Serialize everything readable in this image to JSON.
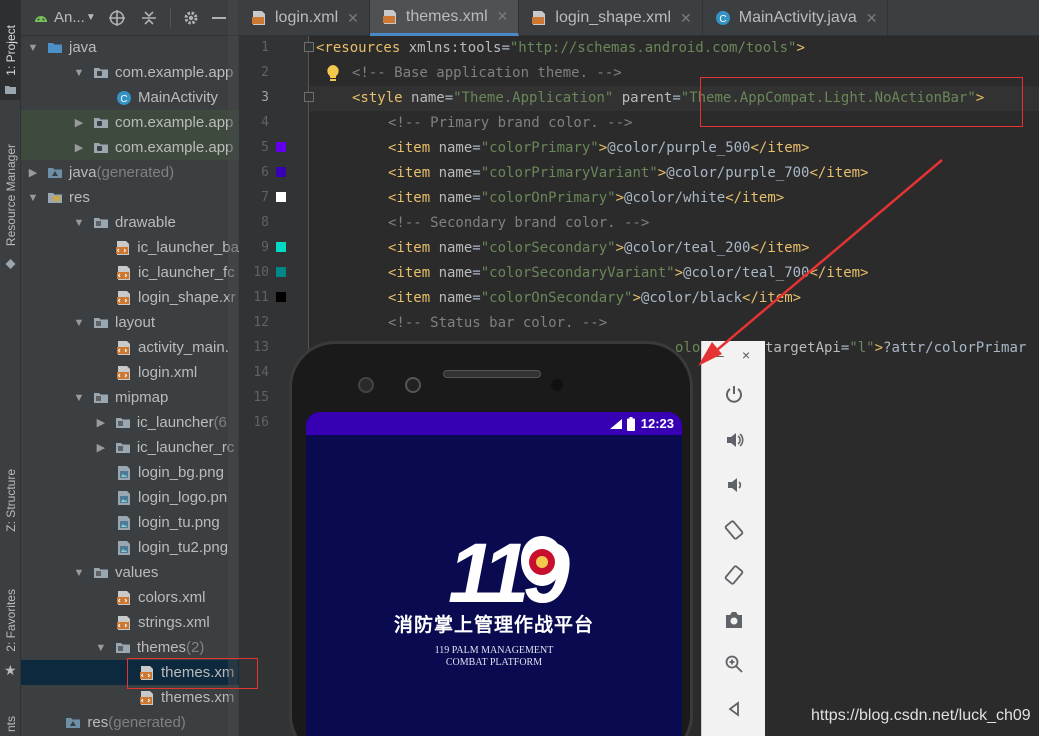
{
  "toolstrip": {
    "project": "1: Project",
    "resource_manager": "Resource Manager",
    "structure": "Z: Structure",
    "favorites": "2: Favorites",
    "bottom_cut": "nts"
  },
  "project_panel": {
    "title": "An...",
    "tree": [
      {
        "label": "java",
        "dim": ""
      },
      {
        "label": "com.example.app",
        "dim": ""
      },
      {
        "label": "MainActivity",
        "dim": ""
      },
      {
        "label": "com.example.app",
        "dim": ""
      },
      {
        "label": "com.example.app",
        "dim": ""
      },
      {
        "label": "java",
        "dim": " (generated)"
      },
      {
        "label": "res",
        "dim": ""
      },
      {
        "label": "drawable",
        "dim": ""
      },
      {
        "label": "ic_launcher_ba",
        "dim": ""
      },
      {
        "label": "ic_launcher_fc",
        "dim": ""
      },
      {
        "label": "login_shape.xr",
        "dim": ""
      },
      {
        "label": "layout",
        "dim": ""
      },
      {
        "label": "activity_main.",
        "dim": ""
      },
      {
        "label": "login.xml",
        "dim": ""
      },
      {
        "label": "mipmap",
        "dim": ""
      },
      {
        "label": "ic_launcher",
        "dim": " (6"
      },
      {
        "label": "ic_launcher_rc",
        "dim": ""
      },
      {
        "label": "login_bg.png",
        "dim": ""
      },
      {
        "label": "login_logo.pn",
        "dim": ""
      },
      {
        "label": "login_tu.png",
        "dim": ""
      },
      {
        "label": "login_tu2.png",
        "dim": ""
      },
      {
        "label": "values",
        "dim": ""
      },
      {
        "label": "colors.xml",
        "dim": ""
      },
      {
        "label": "strings.xml",
        "dim": ""
      },
      {
        "label": "themes",
        "dim": " (2)"
      },
      {
        "label": "themes.xm",
        "dim": ""
      },
      {
        "label": "themes.xm",
        "dim": ""
      },
      {
        "label": "res",
        "dim": " (generated)"
      }
    ]
  },
  "tabs": [
    {
      "label": "login.xml",
      "active": false
    },
    {
      "label": "themes.xml",
      "active": true
    },
    {
      "label": "login_shape.xml",
      "active": false
    },
    {
      "label": "MainActivity.java",
      "active": false
    }
  ],
  "line_numbers": [
    "1",
    "2",
    "3",
    "4",
    "5",
    "6",
    "7",
    "8",
    "9",
    "10",
    "11",
    "12",
    "13",
    "14",
    "15",
    "16"
  ],
  "swatch_colors": {
    "colorPrimary": "#6200ee",
    "colorPrimaryVariant": "#3700b3",
    "colorOnPrimary": "#ffffff",
    "colorSecondary": "#03dac5",
    "colorSecondaryVariant": "#018786",
    "colorOnSecondary": "#000000"
  },
  "code": {
    "l1": [
      "<resources ",
      "xmlns:tools",
      "=",
      "\"http://schemas.android.com/tools\"",
      ">"
    ],
    "l2": "<!-- Base application theme. -->",
    "l3": [
      "<style ",
      "name",
      "=",
      "\"Theme.Application\"",
      " parent",
      "=",
      "\"Theme.AppCompat.Light.NoActionBar\"",
      ">"
    ],
    "l4": "<!-- Primary brand color. -->",
    "l5": [
      "<item ",
      "name",
      "=",
      "\"colorPrimary\"",
      ">",
      "@color/purple_500",
      "</item>"
    ],
    "l6": [
      "<item ",
      "name",
      "=",
      "\"colorPrimaryVariant\"",
      ">",
      "@color/purple_700",
      "</item>"
    ],
    "l7": [
      "<item ",
      "name",
      "=",
      "\"colorOnPrimary\"",
      ">",
      "@color/white",
      "</item>"
    ],
    "l8": "<!-- Secondary brand color. -->",
    "l9": [
      "<item ",
      "name",
      "=",
      "\"colorSecondary\"",
      ">",
      "@color/teal_200",
      "</item>"
    ],
    "l10": [
      "<item ",
      "name",
      "=",
      "\"colorSecondaryVariant\"",
      ">",
      "@color/teal_700",
      "</item>"
    ],
    "l11": [
      "<item ",
      "name",
      "=",
      "\"colorOnSecondary\"",
      ">",
      "@color/black",
      "</item>"
    ],
    "l12": "<!-- Status bar color. -->",
    "l13_a": [
      "olor\"",
      ">"
    ],
    "l13_b": [
      "targetApi",
      "=",
      "\"l\"",
      ">",
      "?attr/colorPrimar"
    ]
  },
  "phone": {
    "time": "12:23",
    "brand_number": "119",
    "brand_cn": "消防掌上管理作战平台",
    "brand_en_1": "119 PALM MANAGEMENT",
    "brand_en_2": "COMBAT PLATFORM"
  },
  "emulator_toolbar": {
    "minimize": "–",
    "close": "×",
    "buttons": [
      "power-icon",
      "volume-up-icon",
      "volume-down-icon",
      "rotate-left-icon",
      "rotate-right-icon",
      "camera-icon",
      "zoom-in-icon",
      "back-icon"
    ]
  },
  "watermark": "https://blog.csdn.net/luck_ch09"
}
